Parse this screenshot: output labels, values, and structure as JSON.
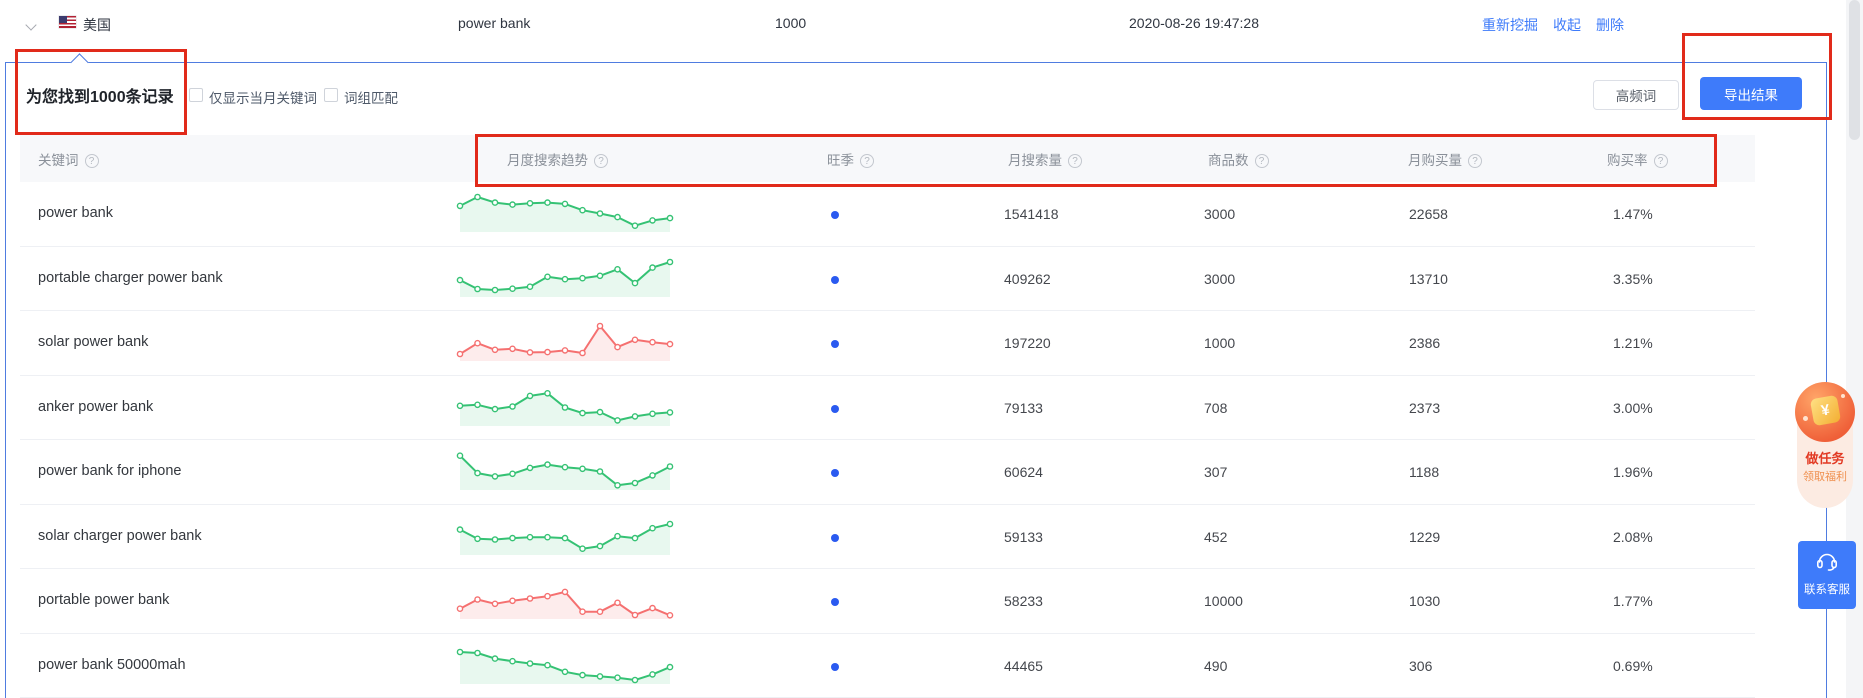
{
  "record_bar": {
    "country": "美国",
    "keyword": "power bank",
    "count": "1000",
    "time": "2020-08-26 19:47:28",
    "actions": {
      "remine": "重新挖掘",
      "collapse": "收起",
      "delete": "删除"
    }
  },
  "toolbar": {
    "result_summary": "为您找到1000条记录",
    "checkbox_current_month": "仅显示当月关键词",
    "checkbox_phrase_match": "词组匹配",
    "high_freq_label": "高频词",
    "export_label": "导出结果"
  },
  "table": {
    "headers": [
      {
        "label": "关键词",
        "help": true
      },
      {
        "label": "月度搜索趋势",
        "help": true
      },
      {
        "label": "旺季",
        "help": true
      },
      {
        "label": "月搜索量",
        "help": true
      },
      {
        "label": "商品数",
        "help": true
      },
      {
        "label": "月购买量",
        "help": true
      },
      {
        "label": "购买率",
        "help": true
      }
    ],
    "rows": [
      {
        "keyword": "power bank",
        "trend_color": "green",
        "peak_season_dot": true,
        "trend": [
          0.7,
          0.97,
          0.8,
          0.74,
          0.78,
          0.8,
          0.76,
          0.57,
          0.47,
          0.36,
          0.1,
          0.26,
          0.33
        ],
        "monthly_search": "1541418",
        "products": "3000",
        "monthly_purchase": "22658",
        "purchase_rate": "1.47%"
      },
      {
        "keyword": "portable charger power bank",
        "trend_color": "green",
        "peak_season_dot": true,
        "trend": [
          0.42,
          0.15,
          0.12,
          0.16,
          0.22,
          0.52,
          0.45,
          0.48,
          0.55,
          0.75,
          0.33,
          0.8,
          0.97
        ],
        "monthly_search": "409262",
        "products": "3000",
        "monthly_purchase": "13710",
        "purchase_rate": "3.35%"
      },
      {
        "keyword": "solar power bank",
        "trend_color": "red",
        "peak_season_dot": true,
        "trend": [
          0.12,
          0.45,
          0.25,
          0.28,
          0.17,
          0.18,
          0.23,
          0.15,
          0.97,
          0.33,
          0.55,
          0.48,
          0.42
        ],
        "monthly_search": "197220",
        "products": "1000",
        "monthly_purchase": "2386",
        "purchase_rate": "1.21%"
      },
      {
        "keyword": "anker power bank",
        "trend_color": "green",
        "peak_season_dot": true,
        "trend": [
          0.52,
          0.55,
          0.42,
          0.5,
          0.82,
          0.9,
          0.47,
          0.3,
          0.33,
          0.08,
          0.2,
          0.28,
          0.32
        ],
        "monthly_search": "79133",
        "products": "708",
        "monthly_purchase": "2373",
        "purchase_rate": "3.00%"
      },
      {
        "keyword": "power bank for iphone",
        "trend_color": "green",
        "peak_season_dot": true,
        "trend": [
          0.95,
          0.42,
          0.32,
          0.4,
          0.58,
          0.68,
          0.6,
          0.55,
          0.47,
          0.05,
          0.12,
          0.35,
          0.62
        ],
        "monthly_search": "60624",
        "products": "307",
        "monthly_purchase": "1188",
        "purchase_rate": "1.96%"
      },
      {
        "keyword": "solar charger power bank",
        "trend_color": "green",
        "peak_season_dot": true,
        "trend": [
          0.68,
          0.4,
          0.38,
          0.42,
          0.45,
          0.45,
          0.42,
          0.1,
          0.18,
          0.48,
          0.42,
          0.72,
          0.85
        ],
        "monthly_search": "59133",
        "products": "452",
        "monthly_purchase": "1229",
        "purchase_rate": "2.08%"
      },
      {
        "keyword": "portable power bank",
        "trend_color": "red",
        "peak_season_dot": true,
        "trend": [
          0.22,
          0.5,
          0.37,
          0.46,
          0.53,
          0.6,
          0.73,
          0.13,
          0.13,
          0.4,
          0.03,
          0.24,
          0.02
        ],
        "monthly_search": "58233",
        "products": "10000",
        "monthly_purchase": "1030",
        "purchase_rate": "1.77%"
      },
      {
        "keyword": "power bank 50000mah",
        "trend_color": "green",
        "peak_season_dot": true,
        "trend": [
          0.88,
          0.85,
          0.68,
          0.6,
          0.53,
          0.48,
          0.28,
          0.18,
          0.14,
          0.1,
          0.03,
          0.2,
          0.42
        ],
        "monthly_search": "44465",
        "products": "490",
        "monthly_purchase": "306",
        "purchase_rate": "0.69%"
      }
    ]
  },
  "floating": {
    "task_badge": {
      "coin_symbol": "¥",
      "line1": "做任务",
      "line2": "领取福利"
    },
    "contact_label": "联系客服"
  },
  "annotations": [
    "records-count-highlight",
    "export-button-highlight",
    "column-headers-highlight"
  ],
  "colors": {
    "accent_blue": "#3e7bfa",
    "annotation_red": "#e12a1a",
    "dot_blue": "#2a5af0",
    "trend_green": "#35c274",
    "trend_green_fill": "#e8f8ef",
    "trend_red": "#f57070",
    "trend_red_fill": "#fdecec"
  }
}
